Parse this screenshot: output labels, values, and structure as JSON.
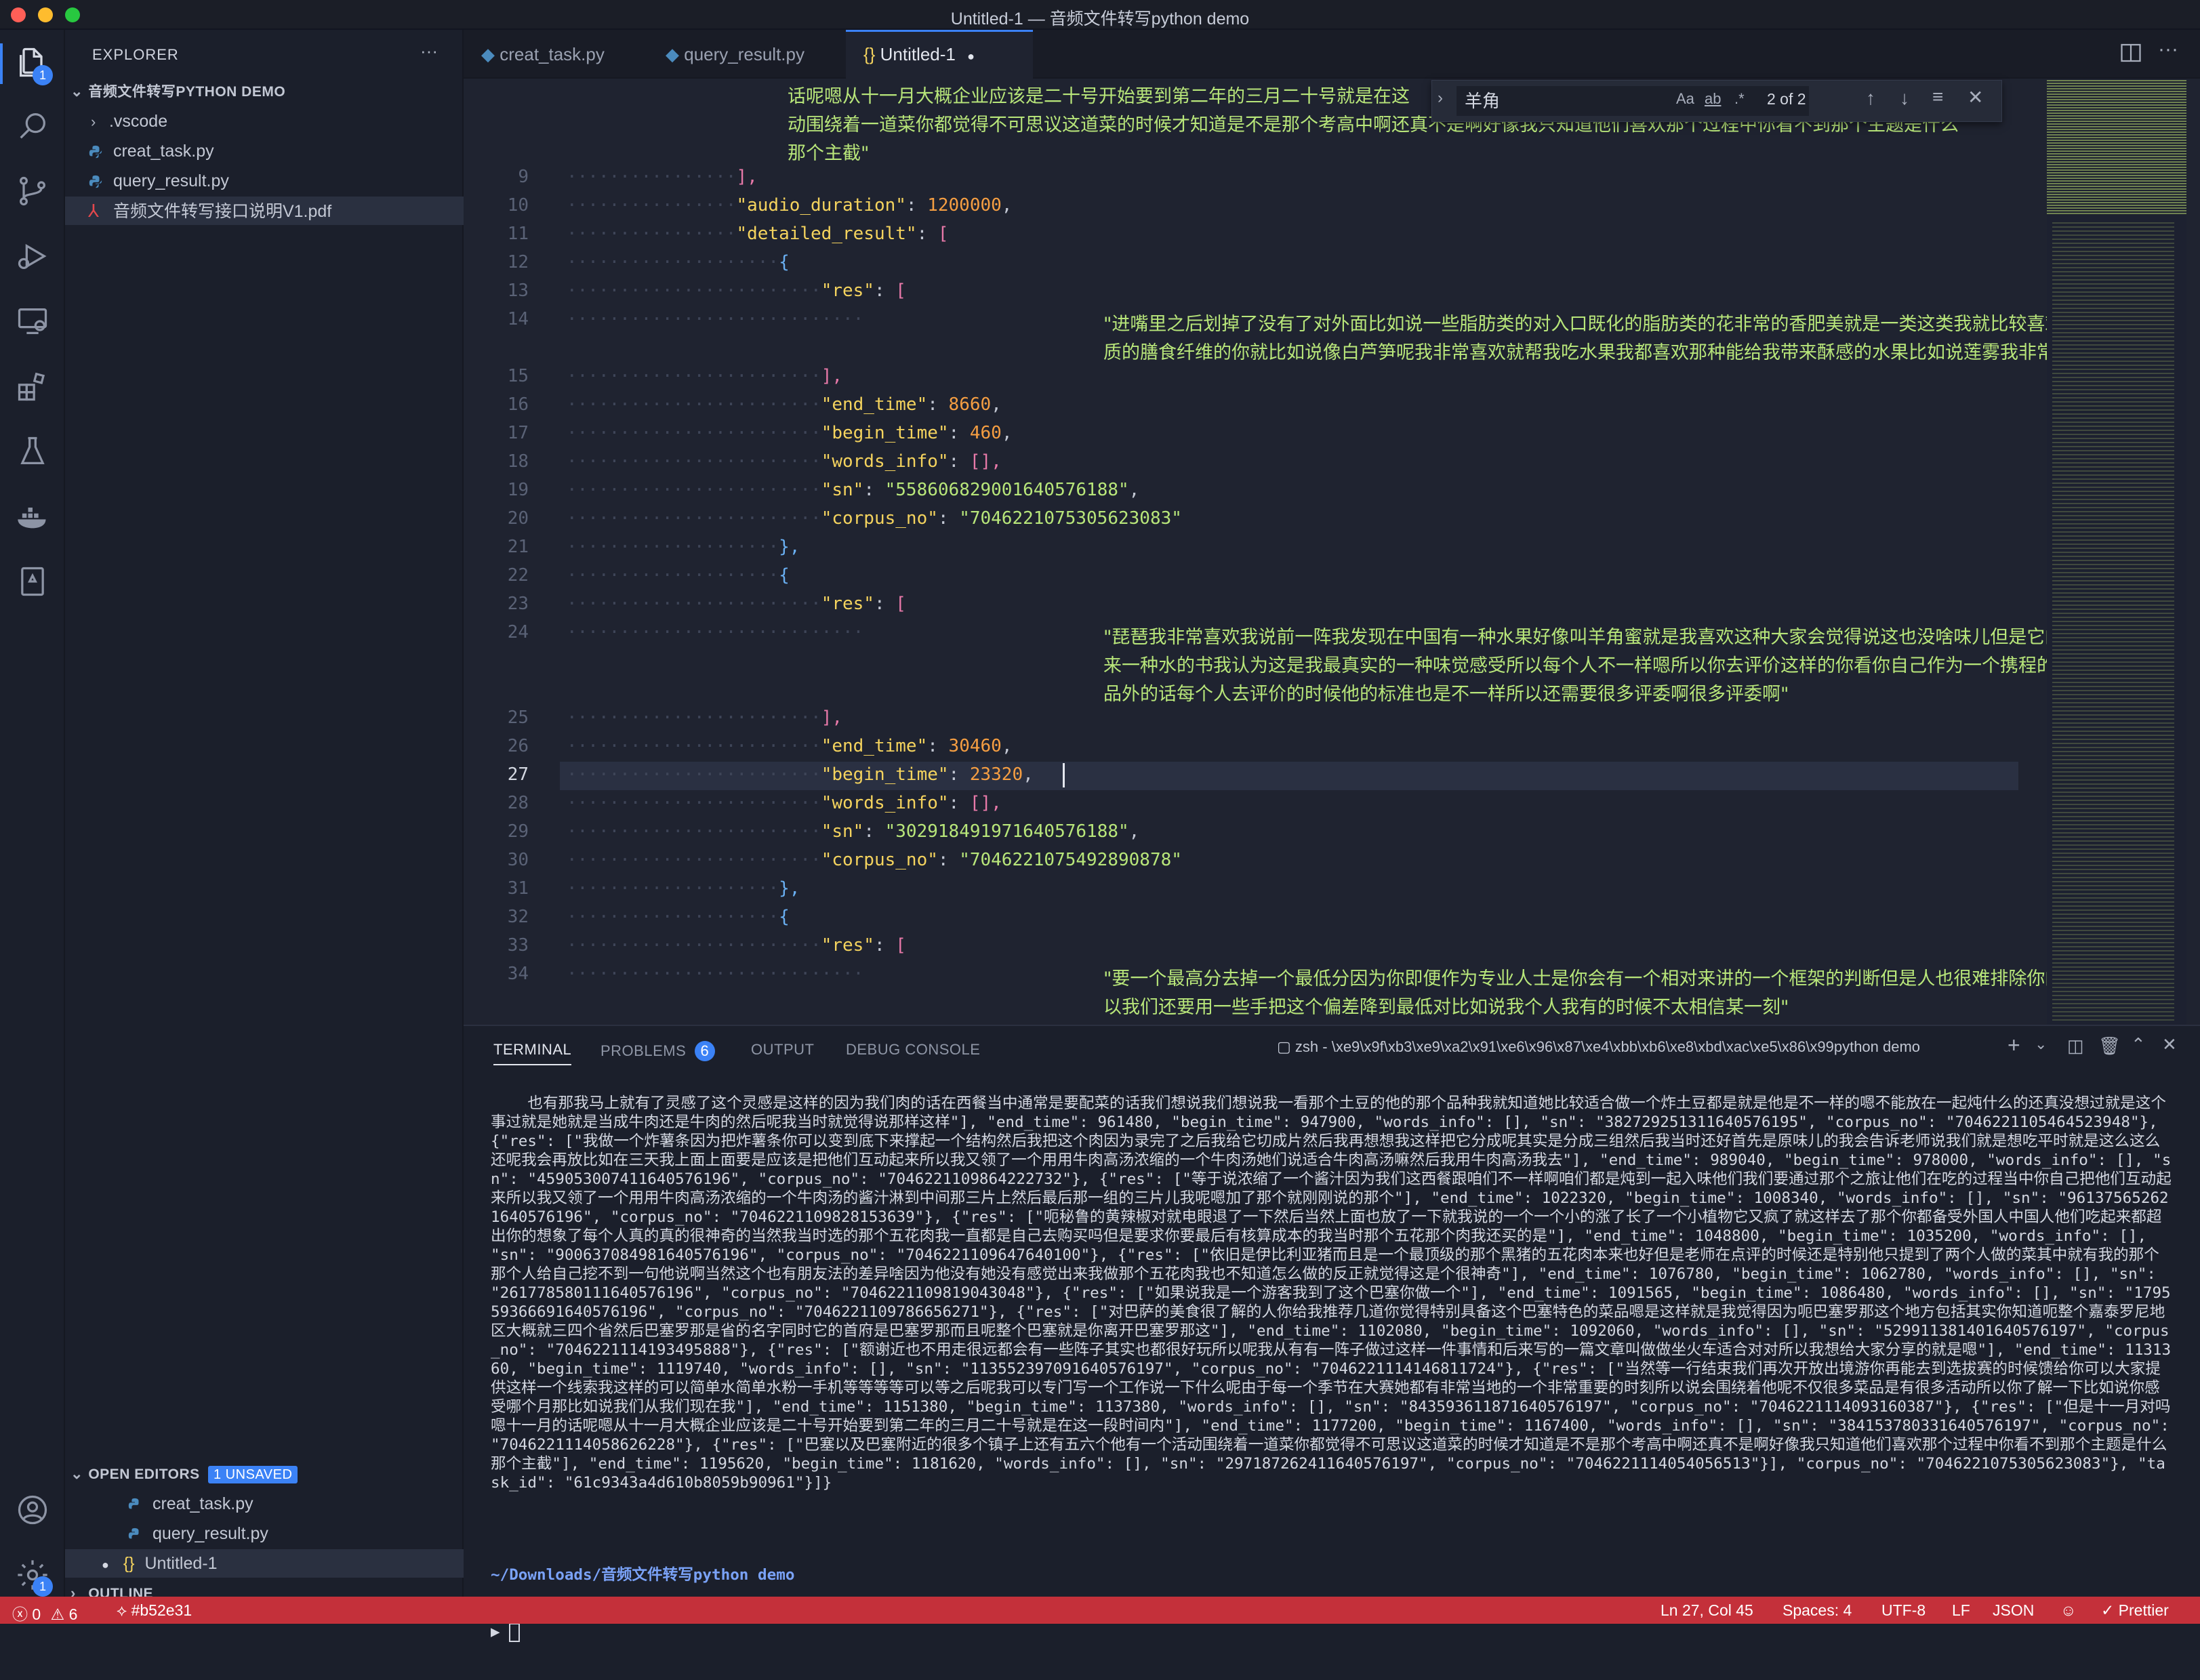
{
  "window": {
    "title": "Untitled-1 — 音频文件转写python demo"
  },
  "activity_bar": {
    "explorer_badge": "1",
    "settings_badge": "1"
  },
  "sidebar": {
    "header": "EXPLORER",
    "more": "···",
    "project": "音频文件转写PYTHON DEMO",
    "files": [
      ".vscode",
      "creat_task.py",
      "query_result.py",
      "音频文件转写接口说明V1.pdf"
    ],
    "open_editors": {
      "label": "OPEN EDITORS",
      "badge": "1 UNSAVED",
      "items": [
        "creat_task.py",
        "query_result.py",
        "Untitled-1"
      ]
    },
    "outline": "OUTLINE"
  },
  "tabs": [
    {
      "label": "creat_task.py"
    },
    {
      "label": "query_result.py"
    },
    {
      "label": "Untitled-1",
      "dirty": "●"
    }
  ],
  "find": {
    "query": "羊角",
    "match_case": "Aa",
    "whole_word": "ab",
    "regex": ".*",
    "count": "2 of 2"
  },
  "editor": {
    "top_text": [
      "话呢嗯从十一月大概企业应该是二十号开始要到第二年的三月二十号就是在这",
      "动围绕着一道菜你都觉得不可思议这道菜的时候才知道是不是那个考高中啊还真不是啊好像我只知道他们喜欢那个过程中你看不到那个主题是什么",
      "那个主截\""
    ],
    "lines": [
      {
        "n": "9",
        "t": "],",
        "c": "brk"
      },
      {
        "n": "10",
        "k": "\"audio_duration\"",
        "v": "1200000",
        "vt": "num"
      },
      {
        "n": "11",
        "k": "\"detailed_result\"",
        "v": "[",
        "vt": "brk"
      },
      {
        "n": "12",
        "t": "{",
        "c": "brk2"
      },
      {
        "n": "13",
        "k": "\"res\"",
        "v": "[",
        "vt": "brk"
      },
      {
        "n": "14",
        "s": "\"进嘴里之后划掉了没有了对外面比如说一些脂肪类的对入口既化的脂肪类的花非常的香肥美就是一类这类我就比较喜欢那种有非常优",
        "s2": "质的膳食纤维的你就比如说像白芦笋呢我非常喜欢就帮我吃水果我都喜欢那种能给我带来酥感的水果比如说莲雾我非常喜欢\""
      },
      {
        "n": "15",
        "t": "],",
        "c": "brk"
      },
      {
        "n": "16",
        "k": "\"end_time\"",
        "v": "8660",
        "vt": "num"
      },
      {
        "n": "17",
        "k": "\"begin_time\"",
        "v": "460",
        "vt": "num"
      },
      {
        "n": "18",
        "k": "\"words_info\"",
        "v": "[],",
        "vt": "brk"
      },
      {
        "n": "19",
        "k": "\"sn\"",
        "v": "\"558606829001640576188\"",
        "vt": "str"
      },
      {
        "n": "20",
        "k": "\"corpus_no\"",
        "v": "\"7046221075305623083\"",
        "vt": "str"
      },
      {
        "n": "21",
        "t": "},",
        "c": "brk2"
      },
      {
        "n": "22",
        "t": "{",
        "c": "brk2"
      },
      {
        "n": "23",
        "k": "\"res\"",
        "v": "[",
        "vt": "brk"
      },
      {
        "n": "24",
        "s": "\"琵琶我非常喜欢我说前一阵我发现在中国有一种水果好像叫羊角蜜就是我喜欢这种大家会觉得说这也没啥味儿但是它的口感是给我带",
        "s2": "来一种水的书我认为这是我最真实的一种味觉感受所以每个人不一样嗯所以你去评价这样的你看你自己作为一个携程的对对对怎么做作",
        "s3": "品外的话每个人去评价的时候他的标准也是不一样所以还需要很多评委啊很多评委啊\""
      },
      {
        "n": "25",
        "t": "],",
        "c": "brk"
      },
      {
        "n": "26",
        "k": "\"end_time\"",
        "v": "30460",
        "vt": "num"
      },
      {
        "n": "27",
        "k": "\"begin_time\"",
        "v": "23320",
        "vt": "num"
      },
      {
        "n": "28",
        "k": "\"words_info\"",
        "v": "[],",
        "vt": "brk"
      },
      {
        "n": "29",
        "k": "\"sn\"",
        "v": "\"302918491971640576188\"",
        "vt": "str"
      },
      {
        "n": "30",
        "k": "\"corpus_no\"",
        "v": "\"7046221075492890878\"",
        "vt": "str"
      },
      {
        "n": "31",
        "t": "},",
        "c": "brk2"
      },
      {
        "n": "32",
        "t": "{",
        "c": "brk2"
      },
      {
        "n": "33",
        "k": "\"res\"",
        "v": "[",
        "vt": "brk"
      },
      {
        "n": "34",
        "s": "\"要一个最高分去掉一个最低分因为你即便作为专业人士是你会有一个相对来讲的一个框架的判断但是人也很难排除你的主观说以后所",
        "s2": "以我们还要用一些手把这个偏差降到最低对比如说我个人我有的时候不太相信某一刻\""
      }
    ]
  },
  "panel": {
    "tabs": [
      "TERMINAL",
      "PROBLEMS",
      "OUTPUT",
      "DEBUG CONSOLE"
    ],
    "problems_count": "6",
    "shell": "zsh - \\xe9\\x9f\\xb3\\xe9\\xa2\\x91\\xe6\\x96\\x87\\xe4\\xbb\\xb6\\xe8\\xbd\\xac\\xe5\\x86\\x99python demo",
    "terminal_text": "也有那我马上就有了灵感了这个灵感是这样的因为我们肉的话在西餐当中通常是要配菜的话我们想说我们想说我一看那个土豆的他的那个品种我就知道她比较适合做一个炸土豆都是就是他是不一样的嗯不能放在一起炖什么的还真没想过就是这个事过就是她就是当成牛肉还是牛肉的然后呢我当时就觉得说那样这样\"], \"end_time\": 961480, \"begin_time\": 947900, \"words_info\": [], \"sn\": \"382729251311640576195\", \"corpus_no\": \"7046221105464523948\"}, {\"res\": [\"我做一个炸薯条因为把炸薯条你可以变到底下来撑起一个结构然后我把这个肉因为录完了之后我给它切成片然后我再想想我这样把它分成呢其实是分成三组然后我当时还好首先是原味儿的我会告诉老师说我们就是想吃平时就是这么这么还呢我会再放比如在三天我上面上面要是应该是把他们互动起来所以我又领了一个用用牛肉高汤浓缩的一个牛肉汤她们说适合牛肉高汤嘛然后我用牛肉高汤我去\"], \"end_time\": 989040, \"begin_time\": 978000, \"words_info\": [], \"sn\": \"459053007411640576196\", \"corpus_no\": \"7046221109864222732\"}, {\"res\": [\"等于说浓缩了一个酱汁因为我们这西餐跟咱们不一样啊咱们都是炖到一起入味他们我们要通过那个之旅让他们在吃的过程当中你自己把他们互动起来所以我又领了一个用用牛肉高汤浓缩的一个牛肉汤的酱汁淋到中间那三片上然后最后那一组的三片儿我呢嗯加了那个就刚刚说的那个\"], \"end_time\": 1022320, \"begin_time\": 1008340, \"words_info\": [], \"sn\": \"961375652621640576196\", \"corpus_no\": \"7046221109828153639\"}, {\"res\": [\"呃秘鲁的黄辣椒对就电眼退了一下然后当然上面也放了一下就我说的一个一个小的涨了长了一个小植物它又疯了就这样去了那个你都备受外国人中国人他们吃起来都超出你的想象了每个人真的真的很神奇的当然我当时选的那个五花肉我一直都是自己去购买吗但是要求你要最后有核算成本的我当时那个五花那个肉我还买的是\"], \"end_time\": 1048800, \"begin_time\": 1035200, \"words_info\": [], \"sn\": \"900637084981640576196\", \"corpus_no\": \"7046221109647640100\"}, {\"res\": [\"依旧是伊比利亚猪而且是一个最顶级的那个黑猪的五花肉本来也好但是老师在点评的时候还是特别他只提到了两个人做的菜其中就有我的那个那个人给自己挖不到一句他说啊当然这个也有朋友法的差异啥因为他没有她没有感觉出来我做那个五花肉我也不知道怎么做的反正就觉得这是个很神奇\"], \"end_time\": 1076780, \"begin_time\": 1062780, \"words_info\": [], \"sn\": \"261778580111640576196\", \"corpus_no\": \"7046221109819043048\"}, {\"res\": [\"如果说我是一个游客我到了这个巴塞你做一个\"], \"end_time\": 1091565, \"begin_time\": 1086480, \"words_info\": [], \"sn\": \"179559366691640576196\", \"corpus_no\": \"7046221109786656271\"}, {\"res\": [\"对巴萨的美食很了解的人你给我推荐几道你觉得特别具备这个巴塞特色的菜品嗯是这样就是我觉得因为呃巴塞罗那这个地方包括其实你知道呃整个嘉泰罗尼地区大概就三四个省然后巴塞罗那是省的名字同时它的首府是巴塞罗那而且呢整个巴塞就是你离开巴塞罗那这\"], \"end_time\": 1102080, \"begin_time\": 1092060, \"words_info\": [], \"sn\": \"529911381401640576197\", \"corpus_no\": \"7046221114193495888\"}, {\"res\": [\"额谢近也不用走很远都会有一些阵子其实也都很好玩所以呢我从有有一阵子做过这样一件事情和后来写的一篇文章叫做做坐火车适合对对所以我想给大家分享的就是嗯\"], \"end_time\": 1131360, \"begin_time\": 1119740, \"words_info\": [], \"sn\": \"113552397091640576197\", \"corpus_no\": \"7046221114146811724\"}, {\"res\": [\"当然等一行结束我们再次开放出境游你再能去到选拔赛的时候馈给你可以大家提供这样一个线索我这样的可以简单水简单水粉一手机等等等等可以等之后呢我可以专门写一个工作说一下什么呢由于每一个季节在大赛她都有非常当地的一个非常重要的时刻所以说会围绕着他呢不仅很多菜品是有很多活动所以你了解一下比如说你感受哪个月那比如说我们从我们现在我\"], \"end_time\": 1151380, \"begin_time\": 1137380, \"words_info\": [], \"sn\": \"843593611871640576197\", \"corpus_no\": \"7046221114093160387\"}, {\"res\": [\"但是十一月对吗嗯十一月的话呢嗯从十一月大概企业应该是二十号开始要到第二年的三月二十号就是在这一段时间内\"], \"end_time\": 1177200, \"begin_time\": 1167400, \"words_info\": [], \"sn\": \"384153780331640576197\", \"corpus_no\": \"7046221114058626228\"}, {\"res\": [\"巴塞以及巴塞附近的很多个镇子上还有五六个他有一个活动围绕着一道菜你都觉得不可思议这道菜的时候才知道是不是那个考高中啊还真不是啊好像我只知道他们喜欢那个过程中你看不到那个主题是什么那个主截\"], \"end_time\": 1195620, \"begin_time\": 1181620, \"words_info\": [], \"sn\": \"297187262411640576197\", \"corpus_no\": \"7046221114054056513\"}], \"corpus_no\": \"7046221075305623083\"}, \"task_id\": \"61c9343a4d610b8059b90961\"}]}",
    "cwd": "~/Downloads/音频文件转写python demo",
    "prompt": "▶"
  },
  "status_bar": {
    "errors": "0",
    "warnings": "6",
    "commit": "#b52e31",
    "position": "Ln 27, Col 45",
    "spaces": "Spaces: 4",
    "encoding": "UTF-8",
    "eol": "LF",
    "language": "JSON",
    "formatter": "Prettier"
  },
  "colors": {
    "accent": "#3b82f6",
    "status_bar": "#c4303a",
    "string": "#b8e67a",
    "key": "#f4d35e",
    "number": "#f59e42"
  }
}
